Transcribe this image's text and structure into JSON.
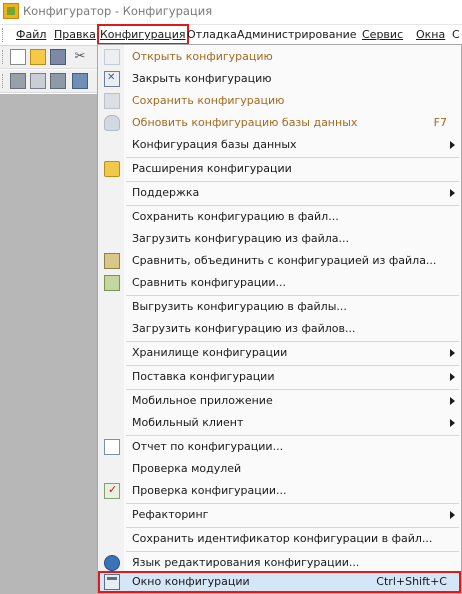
{
  "window": {
    "title": "Конфигуратор - Конфигурация"
  },
  "menubar": {
    "items": [
      {
        "label": "Файл",
        "active": false
      },
      {
        "label": "Правка",
        "active": false
      },
      {
        "label": "Конфигурация",
        "active": true
      },
      {
        "label": "Отладка",
        "active": false
      },
      {
        "label": "Администрирование",
        "active": false
      },
      {
        "label": "Сервис",
        "active": false
      },
      {
        "label": "Окна",
        "active": false
      },
      {
        "label": "С",
        "active": false
      }
    ]
  },
  "dropdown": {
    "items": [
      {
        "label": "Открыть конфигурацию",
        "icon": "open-config-icon",
        "disabled": true
      },
      {
        "label": "Закрыть конфигурацию",
        "icon": "close-config-icon",
        "disabled": false
      },
      {
        "label": "Сохранить конфигурацию",
        "icon": "save-config-icon",
        "disabled": true
      },
      {
        "label": "Обновить конфигурацию базы данных",
        "icon": "update-db-icon",
        "disabled": true,
        "shortcut": "F7"
      },
      {
        "label": "Конфигурация базы данных",
        "submenu": true
      },
      {
        "label": "Расширения конфигурации",
        "icon": "extensions-icon"
      },
      {
        "label": "Поддержка",
        "submenu": true
      },
      {
        "label": "Сохранить конфигурацию в файл..."
      },
      {
        "label": "Загрузить конфигурацию из файла..."
      },
      {
        "label": "Сравнить, объединить с конфигурацией из файла...",
        "icon": "compare-merge-icon"
      },
      {
        "label": "Сравнить конфигурации...",
        "icon": "compare-icon"
      },
      {
        "label": "Выгрузить конфигурацию в файлы..."
      },
      {
        "label": "Загрузить конфигурацию из файлов..."
      },
      {
        "label": "Хранилище конфигурации",
        "submenu": true
      },
      {
        "label": "Поставка конфигурации",
        "submenu": true
      },
      {
        "label": "Мобильное приложение",
        "submenu": true
      },
      {
        "label": "Мобильный клиент",
        "submenu": true
      },
      {
        "label": "Отчет по конфигурации...",
        "icon": "report-icon"
      },
      {
        "label": "Проверка модулей"
      },
      {
        "label": "Проверка конфигурации...",
        "icon": "check-config-icon"
      },
      {
        "label": "Рефакторинг",
        "submenu": true
      },
      {
        "label": "Сохранить идентификатор конфигурации в файл..."
      },
      {
        "label": "Язык редактирования конфигурации...",
        "icon": "language-icon"
      },
      {
        "label": "Окно конфигурации",
        "icon": "config-window-icon",
        "shortcut": "Ctrl+Shift+C",
        "highlighted": true
      }
    ]
  },
  "colors": {
    "highlight_border": "#e01a1a",
    "highlight_fill": "#d5e6f7",
    "disabled_text": "#a36a1e",
    "workspace": "#b7b7b7"
  }
}
